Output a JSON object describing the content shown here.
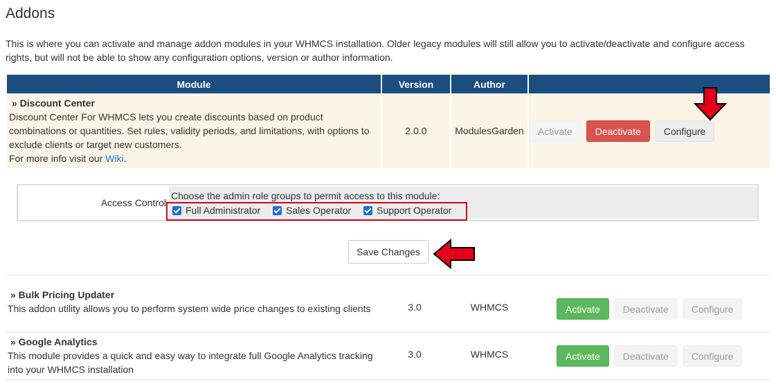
{
  "page": {
    "title": "Addons",
    "intro": "This is where you can activate and manage addon modules in your WHMCS installation. Older legacy modules will still allow you to activate/deactivate and configure access rights, but will not be able to show any configuration options, version or author information."
  },
  "table": {
    "headers": {
      "module": "Module",
      "version": "Version",
      "author": "Author",
      "actions": ""
    }
  },
  "modules": [
    {
      "name": "» Discount Center",
      "description": "Discount Center For WHMCS lets you create discounts based on product combinations or quantities. Set rules, validity periods, and limitations, with options to exclude clients or target new customers.",
      "more_info_prefix": "For more info visit our ",
      "more_info_link": "Wiki",
      "more_info_suffix": ".",
      "version": "2.0.0",
      "author": "ModulesGarden",
      "activate_label": "Activate",
      "deactivate_label": "Deactivate",
      "configure_label": "Configure"
    },
    {
      "name": "» Bulk Pricing Updater",
      "description": "This addon utility allows you to perform system wide price changes to existing clients",
      "version": "3.0",
      "author": "WHMCS",
      "activate_label": "Activate",
      "deactivate_label": "Deactivate",
      "configure_label": "Configure"
    },
    {
      "name": "» Google Analytics",
      "description": "This module provides a quick and easy way to integrate full Google Analytics tracking into your WHMCS installation",
      "version": "3.0",
      "author": "WHMCS",
      "activate_label": "Activate",
      "deactivate_label": "Deactivate",
      "configure_label": "Configure"
    }
  ],
  "access_control": {
    "label": "Access Control",
    "prompt": "Choose the admin role groups to permit access to this module:",
    "roles": [
      {
        "label": "Full Administrator",
        "checked": true
      },
      {
        "label": "Sales Operator",
        "checked": true
      },
      {
        "label": "Support Operator",
        "checked": true
      }
    ]
  },
  "save_button": "Save Changes",
  "colors": {
    "header_bg": "#1a4d80",
    "active_row_bg": "#fdf4e8",
    "danger": "#d9534f",
    "success": "#5cb85c",
    "annotation_red": "#e3001b"
  },
  "annotations": {
    "arrow_icon": "red-arrow-icon",
    "outline": "red-highlight-box"
  }
}
